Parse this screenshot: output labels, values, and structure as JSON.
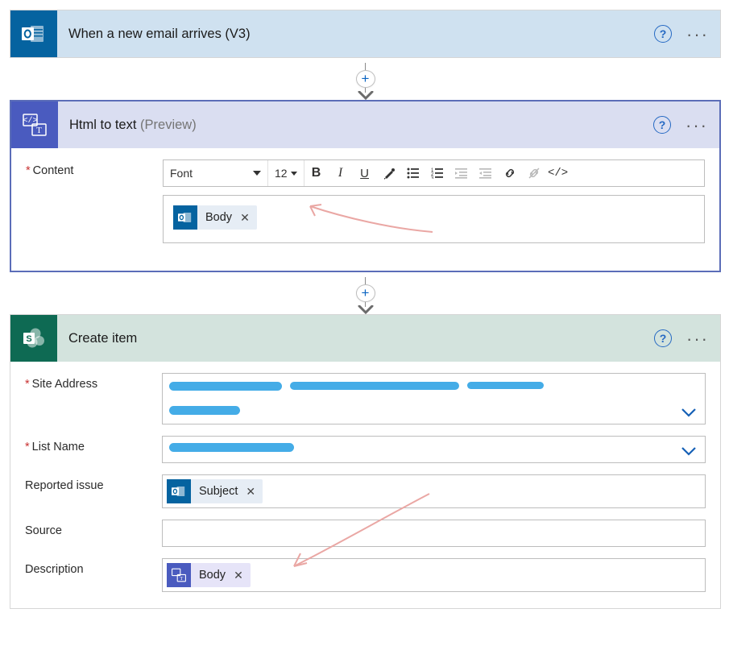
{
  "step1": {
    "title": "When a new email arrives (V3)"
  },
  "step2": {
    "title": "Html to text ",
    "preview": "(Preview)",
    "content_label": "Content",
    "toolbar": {
      "font": "Font",
      "size": "12"
    },
    "token": {
      "label": "Body"
    }
  },
  "step3": {
    "title": "Create item",
    "fields": {
      "site_address_label": "Site Address",
      "list_name_label": "List Name",
      "reported_issue_label": "Reported issue",
      "source_label": "Source",
      "description_label": "Description"
    },
    "tokens": {
      "subject": "Subject",
      "body": "Body"
    }
  }
}
